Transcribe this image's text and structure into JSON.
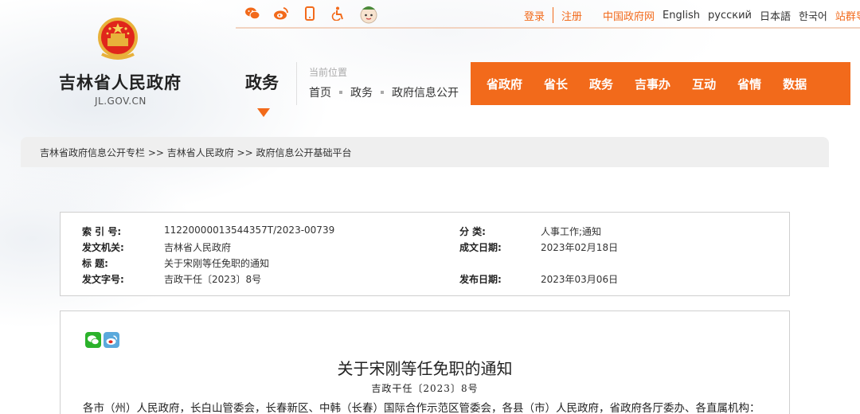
{
  "header": {
    "top_icons": [
      {
        "icon": "wechat-icon"
      },
      {
        "icon": "weibo-icon"
      },
      {
        "icon": "mobile-icon"
      },
      {
        "icon": "accessibility-icon"
      },
      {
        "icon": "mascot-icon"
      }
    ],
    "login": "登录",
    "register": "注册",
    "gov_site": "中国政府网",
    "english": "English",
    "russian": "русский",
    "japanese": "日本語",
    "korean": "한국어",
    "site_nav": "站群导航"
  },
  "logo": {
    "name": "吉林省人民政府",
    "domain": "JL.GOV.CN"
  },
  "section": {
    "title": "政务"
  },
  "location": {
    "label": "当前位置",
    "crumbs": [
      "首页",
      "政务",
      "政府信息公开"
    ]
  },
  "main_nav": [
    "省政府",
    "省长",
    "政务",
    "吉事办",
    "互动",
    "省情",
    "数据"
  ],
  "breadcrumb": "吉林省政府信息公开专栏 >> 吉林省人民政府 >> 政府信息公开基础平台",
  "meta": {
    "index_label": "索 引 号:",
    "index_value": "11220000013544357T/2023-00739",
    "category_label": "分 类:",
    "category_value": "人事工作;通知",
    "issuer_label": "发文机关:",
    "issuer_value": "吉林省人民政府",
    "date_written_label": "成文日期:",
    "date_written_value": "2023年02月18日",
    "title_label": "标 题:",
    "title_value": "关于宋刚等任免职的通知",
    "doc_no_label": "发文字号:",
    "doc_no_value": "吉政干任〔2023〕8号",
    "publish_label": "发布日期:",
    "publish_value": "2023年03月06日"
  },
  "document": {
    "title": "关于宋刚等任免职的通知",
    "number": "吉政干任〔2023〕8号",
    "body_first_line": "各市（州）人民政府，长白山管委会，长春新区、中韩（长春）国际合作示范区管委会，各县（市）人民政府，省政府各厅委办、各直属机构："
  },
  "colors": {
    "accent": "#f26a1b",
    "crumb_bg": "#efefef"
  }
}
